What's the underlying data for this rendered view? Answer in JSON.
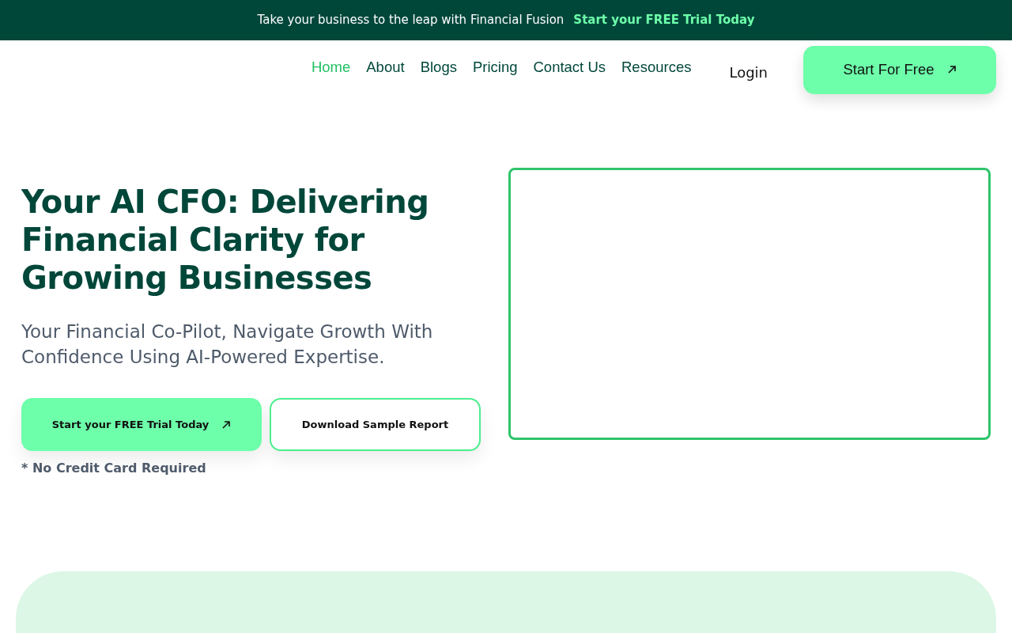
{
  "announcement": {
    "text": "Take your business to the leap with Financial Fusion",
    "link": "Start your FREE Trial Today"
  },
  "nav": [
    {
      "label": "Home",
      "selected": true
    },
    {
      "label": "About",
      "selected": false
    },
    {
      "label": "Blogs",
      "selected": false
    },
    {
      "label": "Pricing",
      "selected": false
    },
    {
      "label": "Contact Us",
      "selected": false
    },
    {
      "label": "Resources",
      "selected": false
    }
  ],
  "login": "Login",
  "cta": "Start For Free",
  "hero": {
    "title": "Your AI CFO: Delivering Financial Clarity for Growing Businesses",
    "subtitle": "Your Financial Co-Pilot, Navigate Growth With Confidence Using AI-Powered Expertise.",
    "primary_button": "Start your FREE Trial Today",
    "secondary_button": "Download Sample Report",
    "note": "* No Credit Card Required"
  }
}
